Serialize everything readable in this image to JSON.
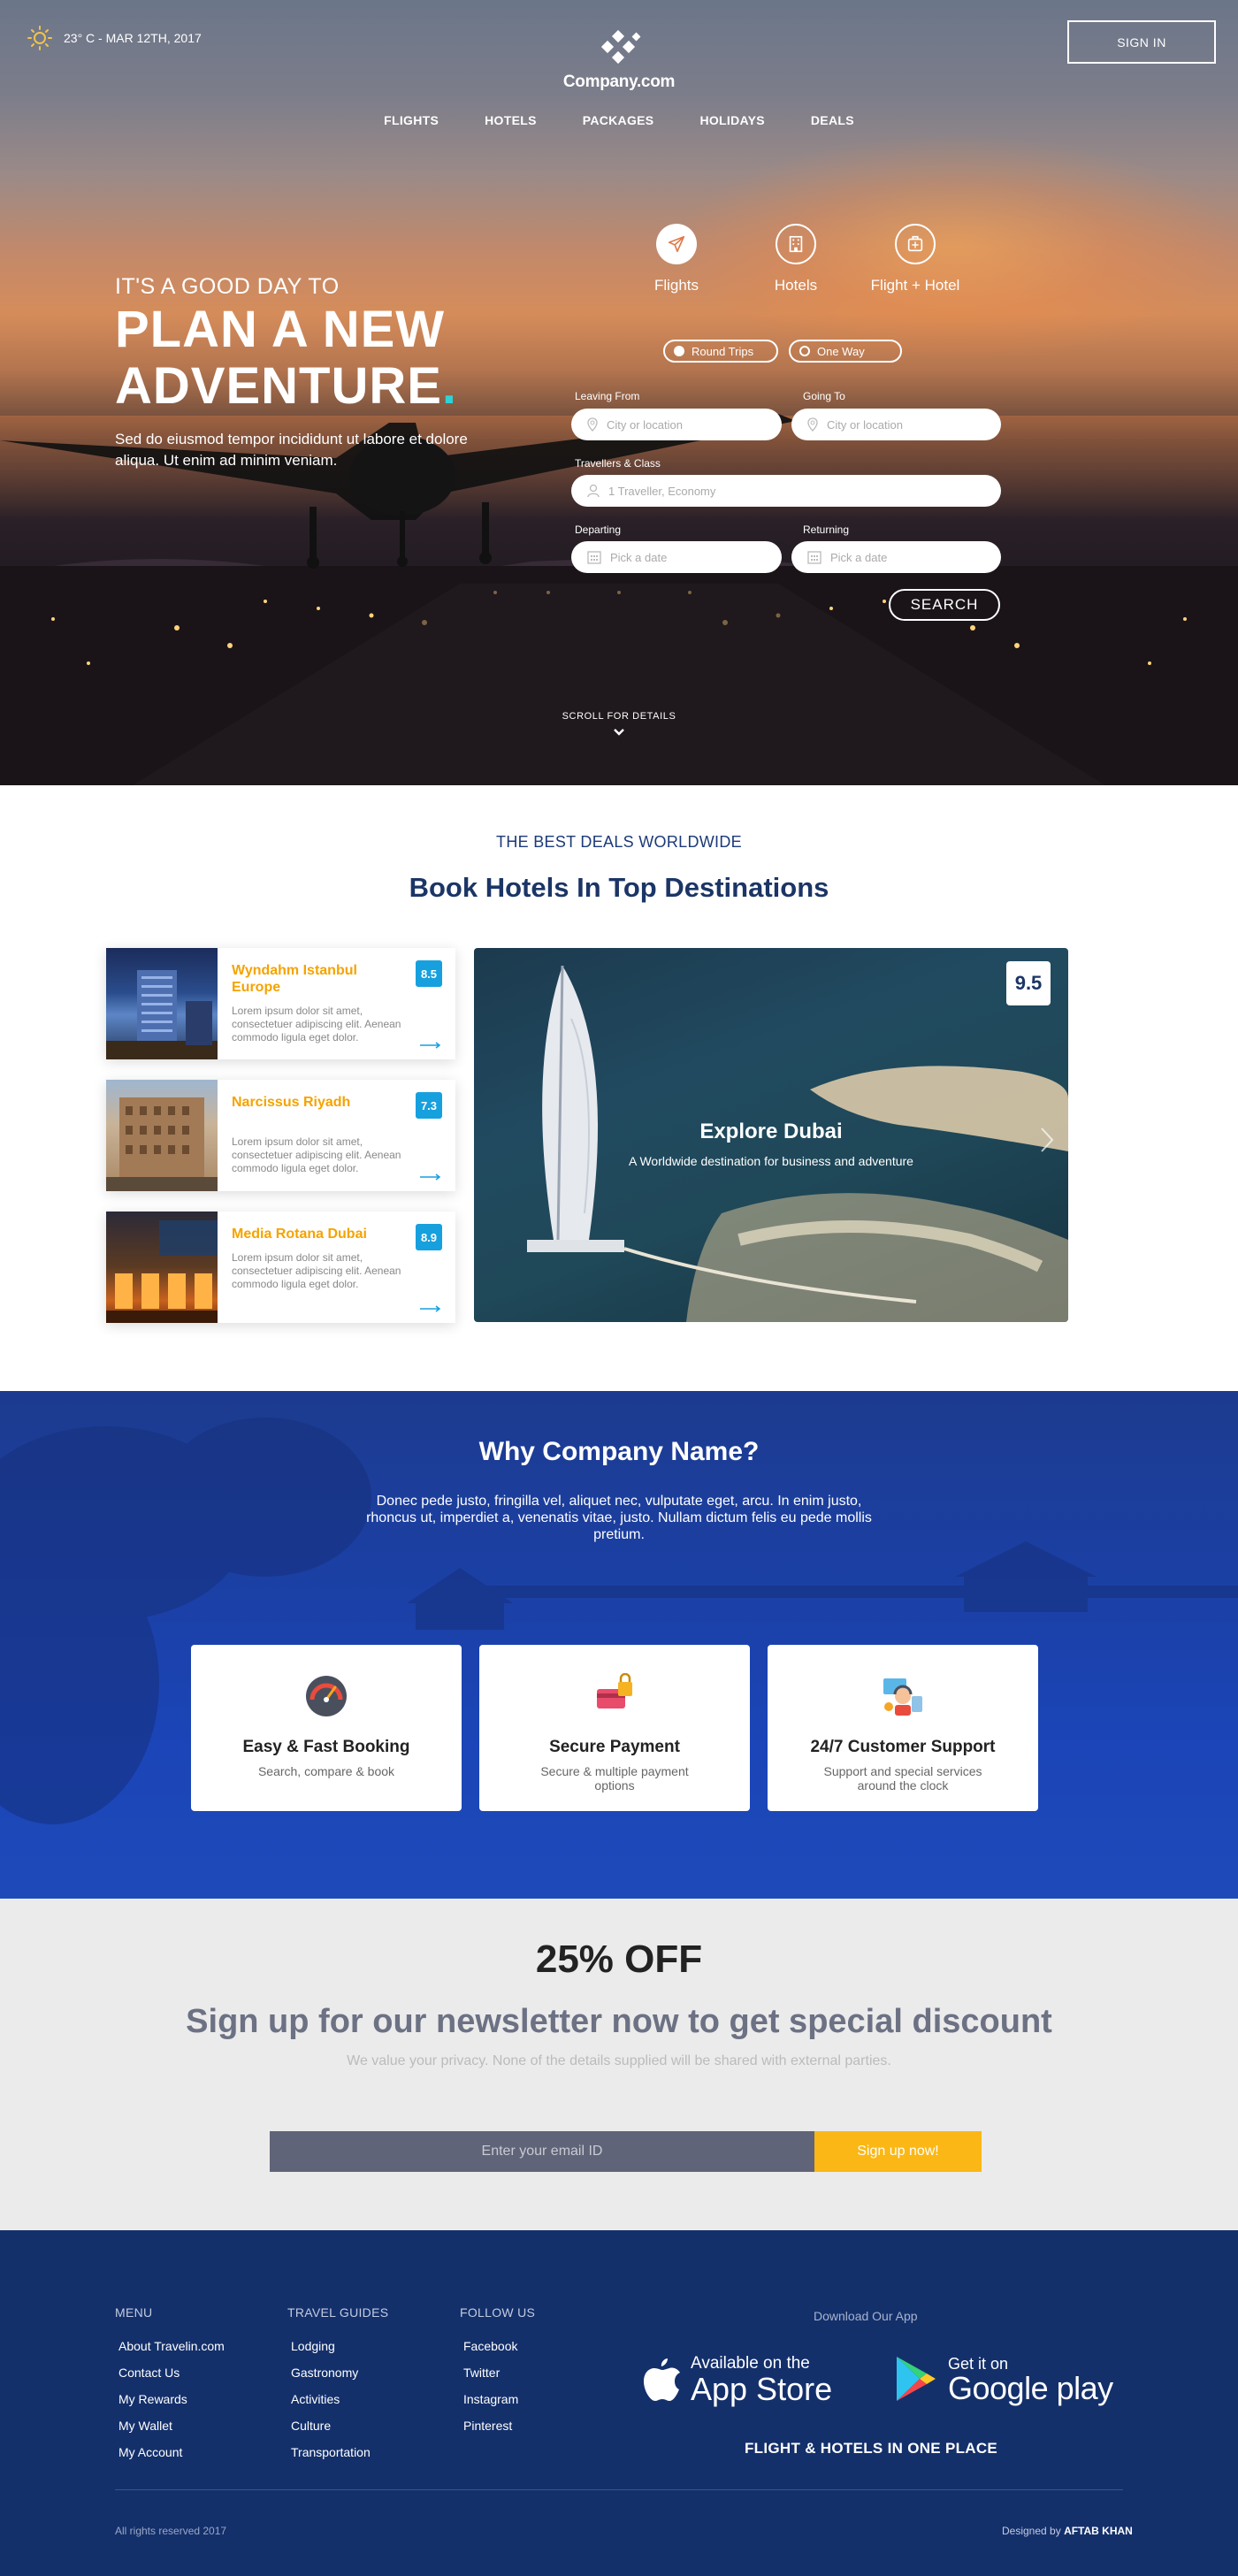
{
  "header": {
    "weather": "23° C - MAR 12TH, 2017",
    "logo": "Company.com",
    "signin": "SIGN IN",
    "nav": [
      "FLIGHTS",
      "HOTELS",
      "PACKAGES",
      "HOLIDAYS",
      "DEALS"
    ]
  },
  "hero": {
    "pre": "IT'S A GOOD DAY TO",
    "line1": "PLAN A NEW",
    "line2": "ADVENTURE",
    "dot": ".",
    "sub": "Sed do eiusmod tempor incididunt ut labore et dolore aliqua. Ut enim ad minim veniam."
  },
  "search": {
    "tabs": [
      "Flights",
      "Hotels",
      "Flight + Hotel"
    ],
    "trip_options": [
      "Round Trips",
      "One Way"
    ],
    "leaving_label": "Leaving From",
    "leaving_placeholder": "City or location",
    "going_label": "Going To",
    "going_placeholder": "City or location",
    "travellers_label": "Travellers & Class",
    "travellers_value": "1 Traveller, Economy",
    "departing_label": "Departing",
    "departing_placeholder": "Pick a date",
    "returning_label": "Returning",
    "returning_placeholder": "Pick a date",
    "button": "SEARCH",
    "scroll": "SCROLL FOR DETAILS"
  },
  "deals": {
    "pre": "THE BEST DEALS WORLDWIDE",
    "title": "Book Hotels In Top Destinations",
    "hotels": [
      {
        "name": "Wyndahm Istanbul Europe",
        "desc": "Lorem ipsum dolor sit amet, consectetuer adipiscing elit. Aenean commodo ligula eget dolor.",
        "score": "8.5"
      },
      {
        "name": "Narcissus Riyadh",
        "desc": "Lorem ipsum dolor sit amet, consectetuer adipiscing elit. Aenean commodo ligula eget dolor.",
        "score": "7.3"
      },
      {
        "name": "Media Rotana Dubai",
        "desc": "Lorem ipsum dolor sit amet, consectetuer adipiscing elit. Aenean commodo ligula eget dolor.",
        "score": "8.9"
      }
    ],
    "feature": {
      "title": "Explore Dubai",
      "subtitle": "A Worldwide destination for business and adventure",
      "score": "9.5"
    }
  },
  "why": {
    "title": "Why Company Name?",
    "desc": "Donec pede justo, fringilla vel, aliquet nec, vulputate eget, arcu. In enim justo, rhoncus ut, imperdiet a, venenatis vitae, justo. Nullam dictum felis eu pede mollis pretium.",
    "cards": [
      {
        "title": "Easy & Fast Booking",
        "text": "Search, compare & book"
      },
      {
        "title": "Secure Payment",
        "text": "Secure & multiple payment options"
      },
      {
        "title": "24/7 Customer Support",
        "text": "Support and special services around the clock"
      }
    ]
  },
  "newsletter": {
    "offer": "25% OFF",
    "heading": "Sign up for our newsletter now to get special discount",
    "privacy": "We value your privacy. None of the details supplied will be shared with external  parties.",
    "email_placeholder": "Enter your email ID",
    "button": "Sign up now!"
  },
  "footer": {
    "menu_title": "MENU",
    "menu": [
      "About Travelin.com",
      "Contact Us",
      "My Rewards",
      "My Wallet",
      "My Account"
    ],
    "guides_title": "TRAVEL GUIDES",
    "guides": [
      "Lodging",
      "Gastronomy",
      "Activities",
      "Culture",
      "Transportation"
    ],
    "follow_title": "FOLLOW US",
    "follow": [
      "Facebook",
      "Twitter",
      "Instagram",
      "Pinterest"
    ],
    "download": "Download Our App",
    "appstore_small": "Available on the",
    "appstore_big": "App Store",
    "gplay_small": "Get it on",
    "gplay_big": "Google play",
    "tagline": "FLIGHT & HOTELS IN ONE PLACE",
    "copyright": "All rights reserved 2017",
    "designed_by": "Designed by",
    "designer": "AFTAB KHAN"
  },
  "colors": {
    "accent_yellow": "#fbb715",
    "hotel_name": "#f5a300",
    "score_blue": "#17a0de",
    "heading_navy": "#1b3566",
    "why_blue": "#1b45b8",
    "footer_navy": "#14306b",
    "dot_cyan": "#2ed3d7"
  },
  "icons": [
    "sun-icon",
    "company-logo-icon",
    "plane-icon",
    "hotel-icon",
    "flight-hotel-icon",
    "location-pin-icon",
    "person-icon",
    "calendar-icon",
    "chevron-down-icon",
    "arrow-right-icon",
    "speedometer-icon",
    "credit-card-lock-icon",
    "support-agent-icon",
    "apple-icon",
    "google-play-icon"
  ]
}
